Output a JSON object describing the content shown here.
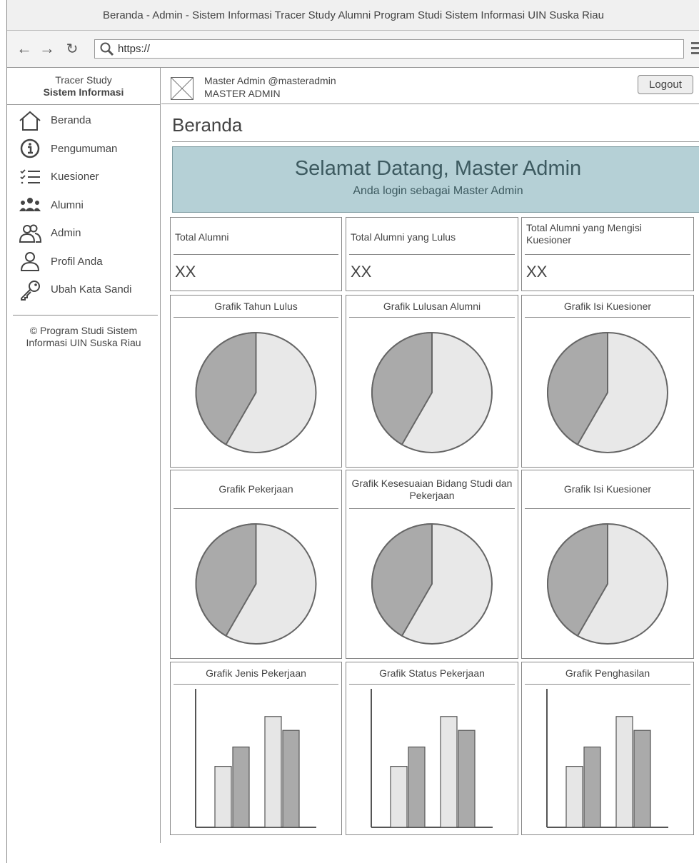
{
  "window": {
    "title": "Beranda - Admin - Sistem Informasi Tracer Study Alumni Program Studi Sistem Informasi UIN Suska Riau"
  },
  "browser": {
    "url": "https://"
  },
  "sidebar": {
    "brand_line1": "Tracer Study",
    "brand_line2": "Sistem Informasi",
    "items": [
      {
        "label": "Beranda",
        "icon": "home-icon"
      },
      {
        "label": "Pengumuman",
        "icon": "info-icon"
      },
      {
        "label": "Kuesioner",
        "icon": "checklist-icon"
      },
      {
        "label": "Alumni",
        "icon": "group-icon"
      },
      {
        "label": "Admin",
        "icon": "users-icon"
      },
      {
        "label": "Profil Anda",
        "icon": "user-icon"
      },
      {
        "label": "Ubah Kata Sandi",
        "icon": "key-icon"
      }
    ],
    "copyright": "© Program Studi Sistem Informasi UIN Suska Riau"
  },
  "header": {
    "user_name": "Master Admin @masteradmin",
    "user_role": "MASTER ADMIN",
    "logout_label": "Logout"
  },
  "main": {
    "page_title": "Beranda",
    "welcome_title": "Selamat Datang, Master Admin",
    "welcome_subtitle": "Anda login sebagai Master Admin",
    "stats": [
      {
        "label": "Total Alumni",
        "value": "XX"
      },
      {
        "label": "Total Alumni yang Lulus",
        "value": "XX"
      },
      {
        "label": "Total Alumni yang Mengisi Kuesioner",
        "value": "XX"
      }
    ],
    "pie_charts": [
      {
        "title": "Grafik Tahun Lulus"
      },
      {
        "title": "Grafik Lulusan Alumni"
      },
      {
        "title": "Grafik Isi Kuesioner"
      },
      {
        "title": "Grafik Pekerjaan"
      },
      {
        "title": "Grafik Kesesuaian Bidang Studi dan Pekerjaan"
      },
      {
        "title": "Grafik Isi Kuesioner"
      }
    ],
    "bar_charts": [
      {
        "title": "Grafik Jenis Pekerjaan"
      },
      {
        "title": "Grafik Status Pekerjaan"
      },
      {
        "title": "Grafik Penghasilan"
      }
    ]
  },
  "colors": {
    "welcome_bg": "#b5d0d6",
    "pie_light": "#e8e8e8",
    "pie_dark": "#aaaaaa",
    "bar_light": "#e6e6e6",
    "bar_dark": "#aaaaaa"
  }
}
